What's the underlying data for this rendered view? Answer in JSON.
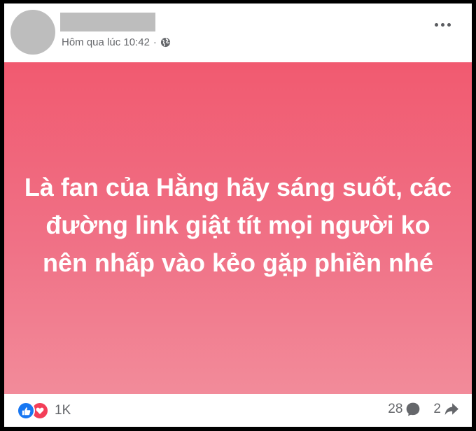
{
  "post": {
    "author_name": "",
    "timestamp": "Hôm qua lúc 10:42",
    "separator": "·",
    "privacy_icon": "globe-icon",
    "menu_icon": "more-options-icon",
    "text": "Là fan của Hằng hãy sáng suốt, các đường link giật tít mọi người ko nên nhấp vào kẻo gặp phiền nhé",
    "background_gradient": [
      "#f15a70",
      "#f28b9a"
    ]
  },
  "footer": {
    "reaction_icons": [
      "like-icon",
      "love-icon"
    ],
    "reaction_count": "1K",
    "comment_count": "28",
    "comment_icon": "comment-icon",
    "share_count": "2",
    "share_icon": "share-icon"
  },
  "colors": {
    "like": "#1877f2",
    "love": "#f33e58",
    "meta_text": "#65676b"
  }
}
